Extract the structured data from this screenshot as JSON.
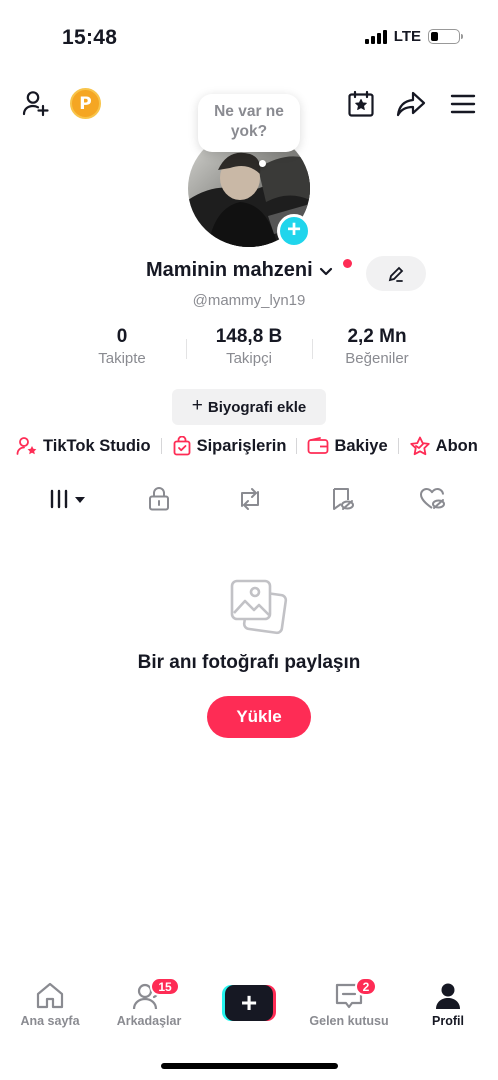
{
  "status_bar": {
    "time": "15:48",
    "network": "LTE",
    "battery_level": 0.25
  },
  "header": {
    "add_friend_icon": "person-plus-icon",
    "coin_label": "P",
    "calendar_icon": "calendar-star-icon",
    "share_icon": "share-arrow-icon",
    "menu_icon": "hamburger-menu-icon"
  },
  "profile": {
    "bubble_text": "Ne var ne yok?",
    "display_name": "Maminin mahzeni",
    "username": "@mammy_lyn19",
    "bio_button": "Biyografi ekle",
    "bio_plus": "+"
  },
  "stats": [
    {
      "value": "0",
      "label": "Takipte"
    },
    {
      "value": "148,8 B",
      "label": "Takipçi"
    },
    {
      "value": "2,2 Mn",
      "label": "Beğeniler"
    }
  ],
  "shortcuts": [
    {
      "label": "TikTok Studio",
      "icon": "person-star-icon"
    },
    {
      "label": "Siparişlerin",
      "icon": "shopping-bag-icon"
    },
    {
      "label": "Bakiye",
      "icon": "wallet-icon"
    },
    {
      "label": "Abon",
      "icon": "subscription-star-icon"
    }
  ],
  "tabs": [
    {
      "name": "grid",
      "icon": "grid-icon"
    },
    {
      "name": "private",
      "icon": "lock-icon"
    },
    {
      "name": "reposts",
      "icon": "repost-icon"
    },
    {
      "name": "favorites",
      "icon": "bookmark-hidden-icon"
    },
    {
      "name": "liked",
      "icon": "heart-hidden-icon"
    }
  ],
  "empty_state": {
    "title": "Bir anı fotoğrafı paylaşın",
    "button": "Yükle"
  },
  "bottom_nav": {
    "home": "Ana sayfa",
    "friends": "Arkadaşlar",
    "friends_badge": "15",
    "create": "+",
    "inbox": "Gelen kutusu",
    "inbox_badge": "2",
    "profile": "Profil"
  },
  "colors": {
    "accent": "#fe2c55",
    "cyan": "#20d5ec",
    "text": "#161823",
    "muted": "#8a8b91",
    "coin": "#f5a623"
  }
}
